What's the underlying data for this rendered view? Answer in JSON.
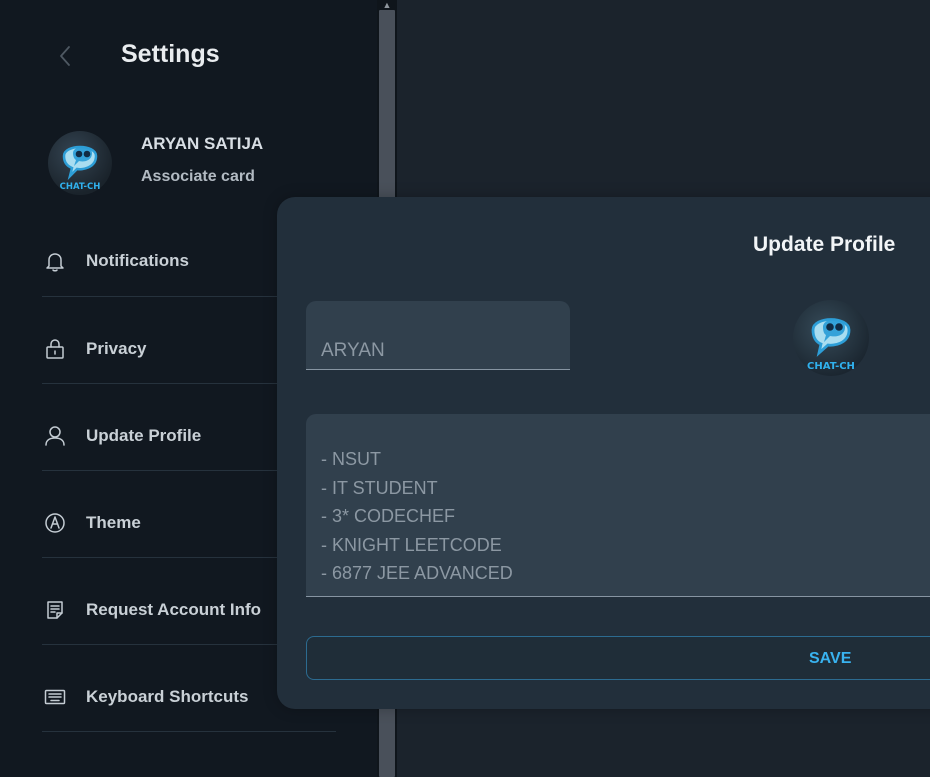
{
  "sidebar": {
    "title": "Settings",
    "back_icon": "chevron-left-icon",
    "profile": {
      "name": "ARYAN SATIJA",
      "subtitle": "Associate card",
      "avatar_logo_text": "CHAT-CH"
    },
    "items": [
      {
        "label": "Notifications",
        "icon": "bell-icon"
      },
      {
        "label": "Privacy",
        "icon": "lock-icon"
      },
      {
        "label": "Update Profile",
        "icon": "user-icon"
      },
      {
        "label": "Theme",
        "icon": "theme-icon"
      },
      {
        "label": "Request Account Info",
        "icon": "document-icon"
      },
      {
        "label": "Keyboard Shortcuts",
        "icon": "keyboard-icon"
      }
    ]
  },
  "modal": {
    "title": "Update Profile",
    "name_value": "ARYAN",
    "avatar_logo_text": "CHAT-CH",
    "bio_lines": [
      "- NSUT",
      "- IT STUDENT",
      "- 3* CODECHEF",
      "- KNIGHT LEETCODE",
      "- 6877 JEE ADVANCED"
    ],
    "save_label": "SAVE"
  },
  "colors": {
    "sidebar_bg": "#111820",
    "main_bg": "#1b232c",
    "modal_bg": "#222f3b",
    "field_bg": "#31404d",
    "accent": "#39b3f0",
    "text_primary": "#f2f5f7",
    "text_secondary": "#c9d0d6"
  }
}
